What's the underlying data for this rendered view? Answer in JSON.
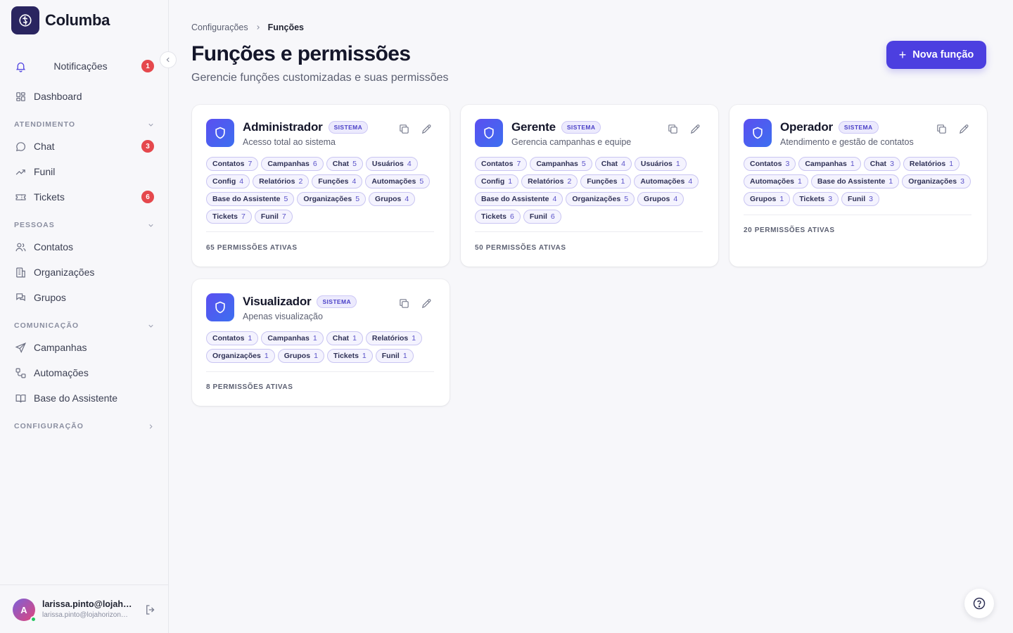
{
  "app": {
    "name": "Columba"
  },
  "sidebar": {
    "notifications": {
      "label": "Notificações",
      "badge": "1"
    },
    "dashboard": {
      "label": "Dashboard"
    },
    "sections": {
      "atendimento": "ATENDIMENTO",
      "pessoas": "PESSOAS",
      "comunicacao": "COMUNICAÇÃO",
      "configuracao": "CONFIGURAÇÃO"
    },
    "items": {
      "chat": {
        "label": "Chat",
        "badge": "3"
      },
      "funil": {
        "label": "Funil"
      },
      "tickets": {
        "label": "Tickets",
        "badge": "6"
      },
      "contatos": {
        "label": "Contatos"
      },
      "organizacoes": {
        "label": "Organizações"
      },
      "grupos": {
        "label": "Grupos"
      },
      "campanhas": {
        "label": "Campanhas"
      },
      "automacoes": {
        "label": "Automações"
      },
      "base": {
        "label": "Base do Assistente"
      }
    },
    "user": {
      "initial": "A",
      "name": "larissa.pinto@lojahorizonte.com",
      "email": "larissa.pinto@lojahorizonte.com"
    }
  },
  "header": {
    "breadcrumb": {
      "parent": "Configurações",
      "current": "Funções"
    },
    "title": "Funções e permissões",
    "subtitle": "Gerencie funções customizadas e suas permissões",
    "new_button": "Nova função"
  },
  "cards": [
    {
      "name": "Administrador",
      "badge": "SISTEMA",
      "description": "Acesso total ao sistema",
      "footer": "65 PERMISSÕES ATIVAS",
      "permissions": [
        {
          "label": "Contatos",
          "count": "7"
        },
        {
          "label": "Campanhas",
          "count": "6"
        },
        {
          "label": "Chat",
          "count": "5"
        },
        {
          "label": "Usuários",
          "count": "4"
        },
        {
          "label": "Config",
          "count": "4"
        },
        {
          "label": "Relatórios",
          "count": "2"
        },
        {
          "label": "Funções",
          "count": "4"
        },
        {
          "label": "Automações",
          "count": "5"
        },
        {
          "label": "Base do Assistente",
          "count": "5"
        },
        {
          "label": "Organizações",
          "count": "5"
        },
        {
          "label": "Grupos",
          "count": "4"
        },
        {
          "label": "Tickets",
          "count": "7"
        },
        {
          "label": "Funil",
          "count": "7"
        }
      ]
    },
    {
      "name": "Gerente",
      "badge": "SISTEMA",
      "description": "Gerencia campanhas e equipe",
      "footer": "50 PERMISSÕES ATIVAS",
      "permissions": [
        {
          "label": "Contatos",
          "count": "7"
        },
        {
          "label": "Campanhas",
          "count": "5"
        },
        {
          "label": "Chat",
          "count": "4"
        },
        {
          "label": "Usuários",
          "count": "1"
        },
        {
          "label": "Config",
          "count": "1"
        },
        {
          "label": "Relatórios",
          "count": "2"
        },
        {
          "label": "Funções",
          "count": "1"
        },
        {
          "label": "Automações",
          "count": "4"
        },
        {
          "label": "Base do Assistente",
          "count": "4"
        },
        {
          "label": "Organizações",
          "count": "5"
        },
        {
          "label": "Grupos",
          "count": "4"
        },
        {
          "label": "Tickets",
          "count": "6"
        },
        {
          "label": "Funil",
          "count": "6"
        }
      ]
    },
    {
      "name": "Operador",
      "badge": "SISTEMA",
      "description": "Atendimento e gestão de contatos",
      "footer": "20 PERMISSÕES ATIVAS",
      "permissions": [
        {
          "label": "Contatos",
          "count": "3"
        },
        {
          "label": "Campanhas",
          "count": "1"
        },
        {
          "label": "Chat",
          "count": "3"
        },
        {
          "label": "Relatórios",
          "count": "1"
        },
        {
          "label": "Automações",
          "count": "1"
        },
        {
          "label": "Base do Assistente",
          "count": "1"
        },
        {
          "label": "Organizações",
          "count": "3"
        },
        {
          "label": "Grupos",
          "count": "1"
        },
        {
          "label": "Tickets",
          "count": "3"
        },
        {
          "label": "Funil",
          "count": "3"
        }
      ]
    },
    {
      "name": "Visualizador",
      "badge": "SISTEMA",
      "description": "Apenas visualização",
      "footer": "8 PERMISSÕES ATIVAS",
      "permissions": [
        {
          "label": "Contatos",
          "count": "1"
        },
        {
          "label": "Campanhas",
          "count": "1"
        },
        {
          "label": "Chat",
          "count": "1"
        },
        {
          "label": "Relatórios",
          "count": "1"
        },
        {
          "label": "Organizações",
          "count": "1"
        },
        {
          "label": "Grupos",
          "count": "1"
        },
        {
          "label": "Tickets",
          "count": "1"
        },
        {
          "label": "Funil",
          "count": "1"
        }
      ]
    }
  ]
}
